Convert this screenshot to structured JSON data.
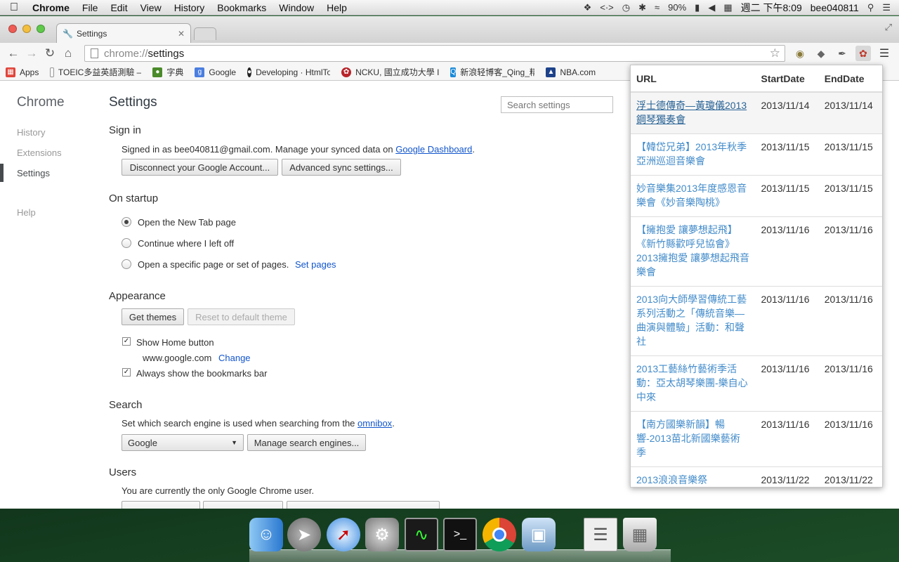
{
  "menubar": {
    "app": "Chrome",
    "items": [
      "File",
      "Edit",
      "View",
      "History",
      "Bookmarks",
      "Window",
      "Help"
    ],
    "battery": "90%",
    "clock": "週二 下午8:09",
    "user": "bee040811"
  },
  "tab": {
    "title": "Settings"
  },
  "toolbar": {
    "url_scheme": "chrome://",
    "url_path": "settings"
  },
  "bookmarks": [
    {
      "label": "Apps",
      "color": "#e0453a"
    },
    {
      "label": "TOEIC多益英語測驗 –",
      "color": "#999999"
    },
    {
      "label": "字典",
      "color": "#4a8a2a"
    },
    {
      "label": "Google",
      "color": "#4a7ee0"
    },
    {
      "label": "Developing · HtmlTo",
      "color": "#222222"
    },
    {
      "label": "NCKU, 國立成功大學 I",
      "color": "#b8242a"
    },
    {
      "label": "新浪轻博客_Qing_精选",
      "color": "#1a8ad8"
    },
    {
      "label": "NBA.com",
      "color": "#1d428a"
    }
  ],
  "nav": {
    "title": "Chrome",
    "items": [
      "History",
      "Extensions",
      "Settings",
      "Help"
    ]
  },
  "settings": {
    "title": "Settings",
    "search_placeholder": "Search settings",
    "signin": {
      "heading": "Sign in",
      "text": "Signed in as bee040811@gmail.com. Manage your synced data on",
      "link": "Google Dashboard",
      "after": ".",
      "disconnect": "Disconnect your Google Account...",
      "advanced": "Advanced sync settings..."
    },
    "startup": {
      "heading": "On startup",
      "options": [
        "Open the New Tab page",
        "Continue where I left off",
        "Open a specific page or set of pages."
      ],
      "set_pages": "Set pages"
    },
    "appearance": {
      "heading": "Appearance",
      "get_themes": "Get themes",
      "reset_theme": "Reset to default theme",
      "show_home": "Show Home button",
      "home_url": "www.google.com",
      "change": "Change",
      "bookmarks_bar": "Always show the bookmarks bar"
    },
    "search": {
      "heading": "Search",
      "text": "Set which search engine is used when searching from the",
      "link": "omnibox",
      "after": ".",
      "engine": "Google",
      "manage": "Manage search engines..."
    },
    "users": {
      "heading": "Users",
      "text": "You are currently the only Google Chrome user."
    }
  },
  "popup": {
    "headers": [
      "URL",
      "StartDate",
      "EndDate"
    ],
    "rows": [
      {
        "title": "浮士德傳奇—黃瓊儀2013鋼琴獨奏會",
        "start": "2013/11/14",
        "end": "2013/11/14"
      },
      {
        "title": "【韓岱兄弟】2013年秋季亞洲巡迴音樂會",
        "start": "2013/11/15",
        "end": "2013/11/15"
      },
      {
        "title": "妙音樂集2013年度感恩音樂會《妙音樂陶桃》",
        "start": "2013/11/15",
        "end": "2013/11/15"
      },
      {
        "title": "【擁抱愛 讓夢想起飛】《新竹縣歡呼兒協會》2013擁抱愛 讓夢想起飛音樂會",
        "start": "2013/11/16",
        "end": "2013/11/16"
      },
      {
        "title": "2013向大師學習傳統工藝系列活動之「傳統音樂—曲演與體驗」活動：和聲社",
        "start": "2013/11/16",
        "end": "2013/11/16"
      },
      {
        "title": "2013工藝絲竹藝術季活動：亞太胡琴樂團-樂自心中來",
        "start": "2013/11/16",
        "end": "2013/11/16"
      },
      {
        "title": "【南方國樂新韻】暢響-2013苗北新國樂藝術季",
        "start": "2013/11/16",
        "end": "2013/11/16"
      },
      {
        "title": "2013浪浪音樂祭",
        "start": "2013/11/22",
        "end": "2013/11/22"
      }
    ]
  },
  "dock": [
    "finder-icon",
    "launchpad-icon",
    "safari-icon",
    "system-preferences-icon",
    "activity-monitor-icon",
    "terminal-icon",
    "chrome-icon",
    "preview-icon",
    "documents-icon",
    "trash-icon"
  ]
}
